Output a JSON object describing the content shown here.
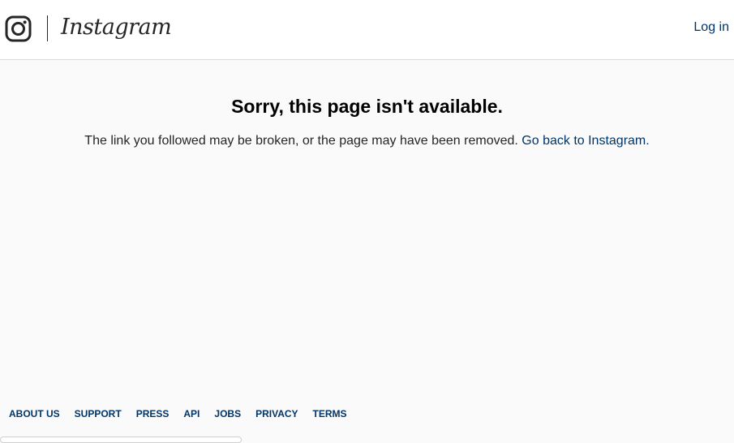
{
  "header": {
    "logo_icon": "instagram-camera-icon",
    "wordmark": "Instagram",
    "login_label": "Log in"
  },
  "main": {
    "title": "Sorry, this page isn't available.",
    "message": "The link you followed may be broken, or the page may have been removed.",
    "back_link": "Go back to Instagram."
  },
  "footer": {
    "links": [
      "ABOUT US",
      "SUPPORT",
      "PRESS",
      "API",
      "JOBS",
      "PRIVACY",
      "TERMS"
    ]
  },
  "colors": {
    "link": "#003569",
    "background": "#fafafa",
    "header_bg": "#ffffff",
    "border": "#dbdbdb",
    "text": "#262626"
  }
}
